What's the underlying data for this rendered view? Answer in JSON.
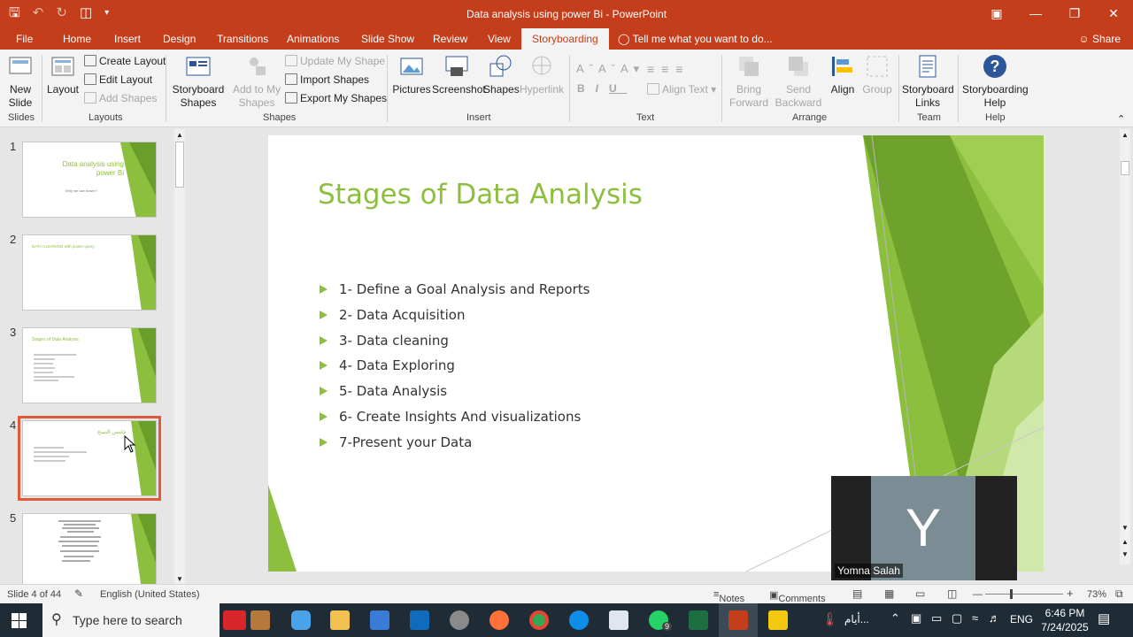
{
  "app": {
    "title": "Data analysis using power Bi - PowerPoint",
    "tabs": [
      "File",
      "Home",
      "Insert",
      "Design",
      "Transitions",
      "Animations",
      "Slide Show",
      "Review",
      "View",
      "Storyboarding"
    ],
    "tell_me": "Tell me what you want to do...",
    "share": "Share"
  },
  "ribbon": {
    "slides": {
      "new_slide": "New Slide",
      "group": "Slides"
    },
    "layouts": {
      "layout": "Layout",
      "create_layout": "Create Layout",
      "edit_layout": "Edit Layout",
      "add_shapes": "Add Shapes",
      "group": "Layouts"
    },
    "shapes": {
      "storyboard_shapes": "Storyboard Shapes",
      "add_to_my_shapes": "Add to My Shapes",
      "update_my_shape": "Update My Shape",
      "import_shapes": "Import Shapes",
      "export_my_shapes": "Export My Shapes",
      "group": "Shapes"
    },
    "insert": {
      "pictures": "Pictures",
      "screenshot": "Screenshot",
      "shapes": "Shapes",
      "hyperlink": "Hyperlink",
      "group": "Insert"
    },
    "text": {
      "align_text": "Align Text",
      "group": "Text"
    },
    "arrange": {
      "bring_forward": "Bring Forward",
      "send_backward": "Send Backward",
      "align": "Align",
      "group_btn": "Group",
      "group": "Arrange"
    },
    "team": {
      "storyboard_links": "Storyboard Links",
      "group": "Team"
    },
    "help": {
      "storyboarding_help": "Storyboarding Help",
      "group": "Help"
    }
  },
  "thumbnails": [
    {
      "num": "1",
      "title": "Data analysis using power Bi",
      "subtitle": "Why we use bower?"
    },
    {
      "num": "2",
      "title": "DATA CLEANING with power query"
    },
    {
      "num": "3",
      "title": "Stages of Data Analysis"
    },
    {
      "num": "4",
      "title": "خامس النسخ"
    },
    {
      "num": "5",
      "title": ""
    }
  ],
  "slide": {
    "title": "Stages of Data Analysis",
    "bullets": [
      "1- Define a Goal Analysis and Reports",
      "2- Data Acquisition",
      "3- Data cleaning",
      "4- Data Exploring",
      "5- Data Analysis",
      "6- Create Insights And visualizations",
      "7-Present your Data"
    ]
  },
  "video": {
    "initial": "Y",
    "name": "Yomna Salah"
  },
  "status": {
    "slide_info": "Slide 4 of 44",
    "language": "English (United States)",
    "notes": "Notes",
    "comments": "Comments",
    "zoom": "73%"
  },
  "taskbar": {
    "search_placeholder": "Type here to search",
    "weather": "أيام...",
    "lang": "ENG",
    "time": "6:46 PM",
    "date": "7/24/2025",
    "badge": "9"
  },
  "colors": {
    "accent": "#c43e1c",
    "green": "#8dbf3e",
    "dark_green": "#6a9e2a",
    "selection": "#e0593b"
  }
}
